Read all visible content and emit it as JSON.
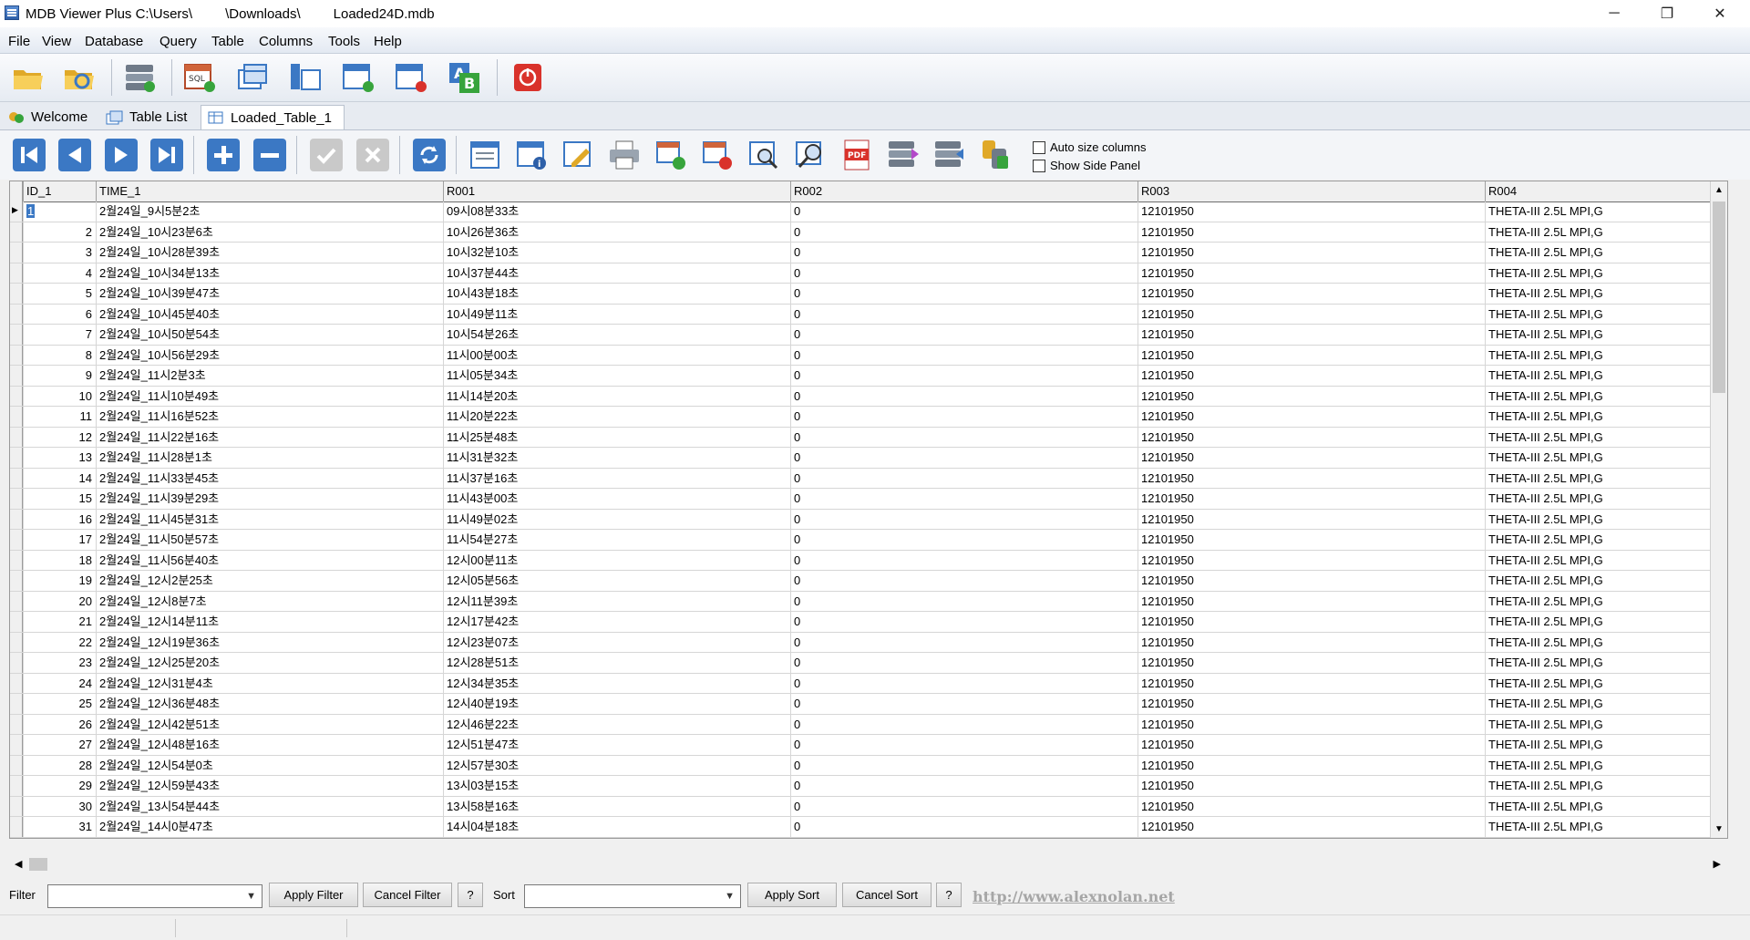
{
  "window": {
    "title_prefix": "MDB Viewer Plus C:\\Users\\",
    "title_mid": "\\Downloads\\",
    "title_suffix": "Loaded24D.mdb",
    "minimize": "─",
    "restore": "❐",
    "close": "✕"
  },
  "menu": [
    "File",
    "View",
    "Database",
    "Query",
    "Table",
    "Columns",
    "Tools",
    "Help"
  ],
  "tabs": {
    "welcome": "Welcome",
    "table_list": "Table List",
    "active": "Loaded_Table_1"
  },
  "options": {
    "auto_size": "Auto size columns",
    "side_panel": "Show Side Panel"
  },
  "columns": [
    "ID_1",
    "TIME_1",
    "R001",
    "R002",
    "R003",
    "R004"
  ],
  "rows": [
    [
      "1",
      "2월24일_9시5분2초",
      "09시08분33초",
      "0",
      "12101950",
      "THETA-III 2.5L MPI,G"
    ],
    [
      "2",
      "2월24일_10시23분6초",
      "10시26분36초",
      "0",
      "12101950",
      "THETA-III 2.5L MPI,G"
    ],
    [
      "3",
      "2월24일_10시28분39초",
      "10시32분10초",
      "0",
      "12101950",
      "THETA-III 2.5L MPI,G"
    ],
    [
      "4",
      "2월24일_10시34분13초",
      "10시37분44초",
      "0",
      "12101950",
      "THETA-III 2.5L MPI,G"
    ],
    [
      "5",
      "2월24일_10시39분47초",
      "10시43분18초",
      "0",
      "12101950",
      "THETA-III 2.5L MPI,G"
    ],
    [
      "6",
      "2월24일_10시45분40초",
      "10시49분11초",
      "0",
      "12101950",
      "THETA-III 2.5L MPI,G"
    ],
    [
      "7",
      "2월24일_10시50분54초",
      "10시54분26초",
      "0",
      "12101950",
      "THETA-III 2.5L MPI,G"
    ],
    [
      "8",
      "2월24일_10시56분29초",
      "11시00분00초",
      "0",
      "12101950",
      "THETA-III 2.5L MPI,G"
    ],
    [
      "9",
      "2월24일_11시2분3초",
      "11시05분34초",
      "0",
      "12101950",
      "THETA-III 2.5L MPI,G"
    ],
    [
      "10",
      "2월24일_11시10분49초",
      "11시14분20초",
      "0",
      "12101950",
      "THETA-III 2.5L MPI,G"
    ],
    [
      "11",
      "2월24일_11시16분52초",
      "11시20분22초",
      "0",
      "12101950",
      "THETA-III 2.5L MPI,G"
    ],
    [
      "12",
      "2월24일_11시22분16초",
      "11시25분48초",
      "0",
      "12101950",
      "THETA-III 2.5L MPI,G"
    ],
    [
      "13",
      "2월24일_11시28분1초",
      "11시31분32초",
      "0",
      "12101950",
      "THETA-III 2.5L MPI,G"
    ],
    [
      "14",
      "2월24일_11시33분45초",
      "11시37분16초",
      "0",
      "12101950",
      "THETA-III 2.5L MPI,G"
    ],
    [
      "15",
      "2월24일_11시39분29초",
      "11시43분00초",
      "0",
      "12101950",
      "THETA-III 2.5L MPI,G"
    ],
    [
      "16",
      "2월24일_11시45분31초",
      "11시49분02초",
      "0",
      "12101950",
      "THETA-III 2.5L MPI,G"
    ],
    [
      "17",
      "2월24일_11시50분57초",
      "11시54분27초",
      "0",
      "12101950",
      "THETA-III 2.5L MPI,G"
    ],
    [
      "18",
      "2월24일_11시56분40초",
      "12시00분11초",
      "0",
      "12101950",
      "THETA-III 2.5L MPI,G"
    ],
    [
      "19",
      "2월24일_12시2분25초",
      "12시05분56초",
      "0",
      "12101950",
      "THETA-III 2.5L MPI,G"
    ],
    [
      "20",
      "2월24일_12시8분7초",
      "12시11분39초",
      "0",
      "12101950",
      "THETA-III 2.5L MPI,G"
    ],
    [
      "21",
      "2월24일_12시14분11초",
      "12시17분42초",
      "0",
      "12101950",
      "THETA-III 2.5L MPI,G"
    ],
    [
      "22",
      "2월24일_12시19분36초",
      "12시23분07초",
      "0",
      "12101950",
      "THETA-III 2.5L MPI,G"
    ],
    [
      "23",
      "2월24일_12시25분20초",
      "12시28분51초",
      "0",
      "12101950",
      "THETA-III 2.5L MPI,G"
    ],
    [
      "24",
      "2월24일_12시31분4초",
      "12시34분35초",
      "0",
      "12101950",
      "THETA-III 2.5L MPI,G"
    ],
    [
      "25",
      "2월24일_12시36분48초",
      "12시40분19초",
      "0",
      "12101950",
      "THETA-III 2.5L MPI,G"
    ],
    [
      "26",
      "2월24일_12시42분51초",
      "12시46분22초",
      "0",
      "12101950",
      "THETA-III 2.5L MPI,G"
    ],
    [
      "27",
      "2월24일_12시48분16초",
      "12시51분47초",
      "0",
      "12101950",
      "THETA-III 2.5L MPI,G"
    ],
    [
      "28",
      "2월24일_12시54분0초",
      "12시57분30초",
      "0",
      "12101950",
      "THETA-III 2.5L MPI,G"
    ],
    [
      "29",
      "2월24일_12시59분43초",
      "13시03분15초",
      "0",
      "12101950",
      "THETA-III 2.5L MPI,G"
    ],
    [
      "30",
      "2월24일_13시54분44초",
      "13시58분16초",
      "0",
      "12101950",
      "THETA-III 2.5L MPI,G"
    ],
    [
      "31",
      "2월24일_14시0분47초",
      "14시04분18초",
      "0",
      "12101950",
      "THETA-III 2.5L MPI,G"
    ]
  ],
  "filterbar": {
    "filter_label": "Filter",
    "apply_filter": "Apply Filter",
    "cancel_filter": "Cancel Filter",
    "help": "?",
    "sort_label": "Sort",
    "apply_sort": "Apply Sort",
    "cancel_sort": "Cancel Sort",
    "link": "http://www.alexnolan.net"
  },
  "icons": {
    "toolbar": [
      "open-folder-icon",
      "open-recent-icon",
      "database-add-icon",
      "sql-query-icon",
      "tables-icon",
      "columns-icon",
      "add-table-icon",
      "delete-table-icon",
      "rename-icon",
      "exit-icon"
    ],
    "navigator": [
      "first-record-icon",
      "prev-record-icon",
      "next-record-icon",
      "last-record-icon",
      "add-record-icon",
      "delete-record-icon",
      "post-edit-icon",
      "cancel-edit-icon",
      "refresh-icon"
    ]
  },
  "colors": {
    "nav_blue": "#3b78c4",
    "exit_red": "#d9322b",
    "link_gray": "#a6a6a6"
  }
}
